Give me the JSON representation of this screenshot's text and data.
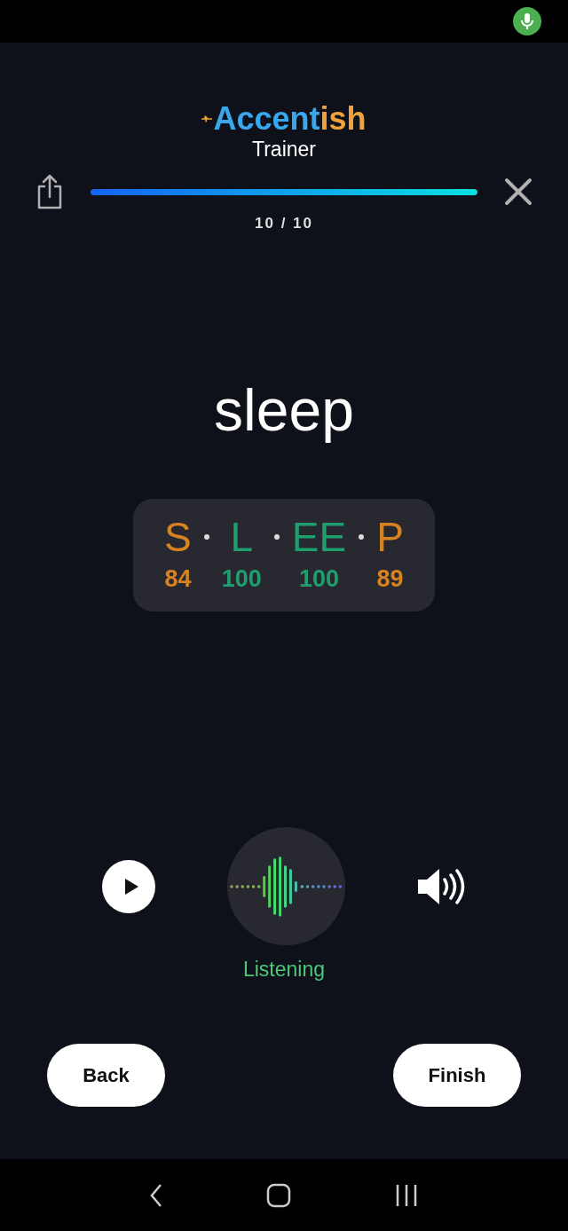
{
  "logo": {
    "parts": [
      {
        "text": "Accent",
        "color": "#3aa6ec"
      },
      {
        "text": "ish",
        "color": "#f0a33a"
      }
    ],
    "subtitle": "Trainer"
  },
  "progress": {
    "level": 1.0,
    "count": "10 / 10"
  },
  "word": "sleep",
  "phonemes": [
    {
      "symbol": "S",
      "score": "84",
      "color": "#d98320"
    },
    {
      "symbol": "L",
      "score": "100",
      "color": "#1f9e6e"
    },
    {
      "symbol": "EE",
      "score": "100",
      "color": "#1f9e6e"
    },
    {
      "symbol": "P",
      "score": "89",
      "color": "#d98320"
    }
  ],
  "recorder": {
    "status": "Listening"
  },
  "buttons": [
    {
      "label": "Back",
      "kind": "back"
    },
    {
      "label": "Finish",
      "kind": "finish"
    }
  ]
}
